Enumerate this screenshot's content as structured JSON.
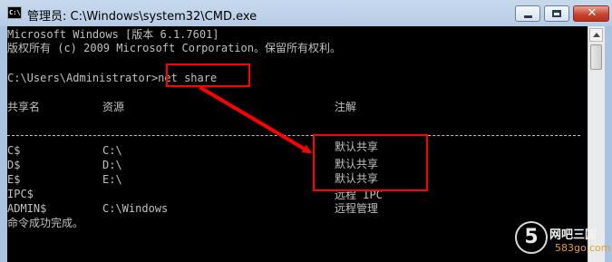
{
  "window": {
    "title": "管理员: C:\\Windows\\system32\\CMD.exe",
    "icon_label": "C:\\"
  },
  "console": {
    "header_line_1": "Microsoft Windows [版本 6.1.7601]",
    "header_line_2": "版权所有 (c) 2009 Microsoft Corporation。保留所有权利。",
    "prompt": "C:\\Users\\Administrator>",
    "command": "net share",
    "columns": [
      "共享名",
      "资源",
      "注解"
    ],
    "shares": [
      {
        "name": "C$",
        "resource": "C:\\",
        "remark": "默认共享"
      },
      {
        "name": "D$",
        "resource": "D:\\",
        "remark": "默认共享"
      },
      {
        "name": "E$",
        "resource": "E:\\",
        "remark": "默认共享"
      },
      {
        "name": "IPC$",
        "resource": "",
        "remark": "远程 IPC"
      },
      {
        "name": "ADMIN$",
        "resource": "C:\\Windows",
        "remark": "远程管理"
      }
    ],
    "completion": "命令成功完成。"
  },
  "watermark": {
    "logo": "5",
    "name": "网吧三国",
    "url": "583go.com"
  },
  "colors": {
    "console_bg": "#000000",
    "console_text": "#c0c0c0",
    "annotation": "#ff0000"
  }
}
